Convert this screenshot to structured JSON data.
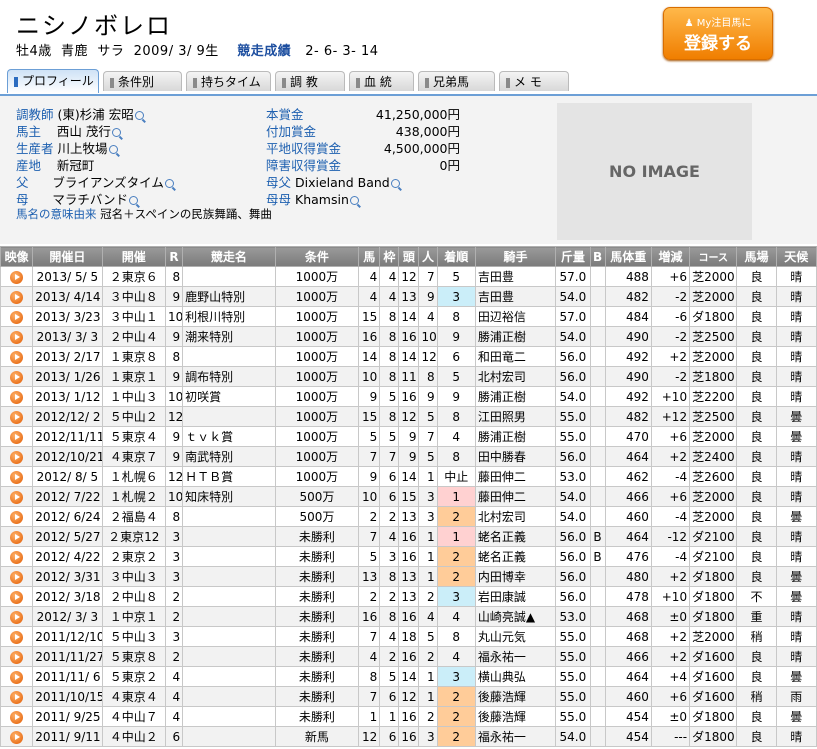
{
  "horse": {
    "name": "ニシノボレロ",
    "sex_age": "牡4歳",
    "color": "青鹿",
    "breed": "サラ",
    "birth": "2009/ 3/ 9生",
    "record_label": "競走成績",
    "record": "2- 6- 3- 14"
  },
  "register_button": {
    "small": "My注目馬に",
    "big": "登録する"
  },
  "tabs": [
    "プロフィール",
    "条件別",
    "持ちタイム",
    "調 教",
    "血 統",
    "兄弟馬",
    "メ モ"
  ],
  "profile": {
    "trainer_label": "調教師",
    "trainer": "(東)杉浦 宏昭",
    "owner_label": "馬主",
    "owner": "西山 茂行",
    "breeder_label": "生産者",
    "breeder": "川上牧場",
    "origin_label": "産地",
    "origin": "新冠町",
    "sire_label": "父",
    "sire": "ブライアンズタイム",
    "dam_label": "母",
    "dam": "マラチバンド",
    "meaning_label": "馬名の意味由来",
    "meaning": "冠名＋スペインの民族舞踊、舞曲",
    "prize_label": "本賞金",
    "prize": "41,250,000円",
    "extra_label": "付加賞金",
    "extra": "438,000円",
    "flat_label": "平地収得賞金",
    "flat": "4,500,000円",
    "hurdle_label": "障害収得賞金",
    "hurdle": "0円",
    "damsire_label": "母父",
    "damsire": "Dixieland Band",
    "damdam_label": "母母",
    "damdam": "Khamsin",
    "no_image": "NO IMAGE"
  },
  "table": {
    "headers": [
      "映像",
      "開催日",
      "開催",
      "R",
      "競走名",
      "条件",
      "馬",
      "枠",
      "頭",
      "人",
      "着順",
      "騎手",
      "斤量",
      "B",
      "馬体重",
      "増減",
      "コース",
      "馬場",
      "天候"
    ],
    "rows": [
      [
        "2013/ 5/ 5",
        "２東京６",
        "8",
        "",
        "1000万",
        "4",
        "4",
        "12",
        "7",
        "5",
        "吉田豊",
        "57.0",
        "",
        "488",
        "+6",
        "芝2000",
        "良",
        "晴"
      ],
      [
        "2013/ 4/14",
        "３中山８",
        "9",
        "鹿野山特別",
        "1000万",
        "4",
        "4",
        "13",
        "9",
        "3",
        "吉田豊",
        "54.0",
        "",
        "482",
        "-2",
        "芝2000",
        "良",
        "晴"
      ],
      [
        "2013/ 3/23",
        "３中山１",
        "10",
        "利根川特別",
        "1000万",
        "15",
        "8",
        "14",
        "4",
        "8",
        "田辺裕信",
        "57.0",
        "",
        "484",
        "-6",
        "ダ1800",
        "良",
        "晴"
      ],
      [
        "2013/ 3/ 3",
        "２中山４",
        "9",
        "潮来特別",
        "1000万",
        "16",
        "8",
        "16",
        "10",
        "9",
        "勝浦正樹",
        "54.0",
        "",
        "490",
        "-2",
        "芝2500",
        "良",
        "晴"
      ],
      [
        "2013/ 2/17",
        "１東京８",
        "8",
        "",
        "1000万",
        "14",
        "8",
        "14",
        "12",
        "6",
        "和田竜二",
        "56.0",
        "",
        "492",
        "+2",
        "芝2000",
        "良",
        "晴"
      ],
      [
        "2013/ 1/26",
        "１東京１",
        "9",
        "調布特別",
        "1000万",
        "10",
        "8",
        "11",
        "8",
        "5",
        "北村宏司",
        "56.0",
        "",
        "490",
        "-2",
        "芝1800",
        "良",
        "晴"
      ],
      [
        "2013/ 1/12",
        "１中山３",
        "10",
        "初咲賞",
        "1000万",
        "9",
        "5",
        "16",
        "9",
        "9",
        "勝浦正樹",
        "54.0",
        "",
        "492",
        "+10",
        "芝2200",
        "良",
        "晴"
      ],
      [
        "2012/12/ 2",
        "５中山２",
        "12",
        "",
        "1000万",
        "15",
        "8",
        "12",
        "5",
        "8",
        "江田照男",
        "55.0",
        "",
        "482",
        "+12",
        "芝2500",
        "良",
        "曇"
      ],
      [
        "2012/11/11",
        "５東京４",
        "9",
        "ｔｖｋ賞",
        "1000万",
        "5",
        "5",
        "9",
        "7",
        "4",
        "勝浦正樹",
        "55.0",
        "",
        "470",
        "+6",
        "芝2000",
        "良",
        "曇"
      ],
      [
        "2012/10/21",
        "４東京７",
        "9",
        "南武特別",
        "1000万",
        "7",
        "7",
        "9",
        "5",
        "8",
        "田中勝春",
        "56.0",
        "",
        "464",
        "+2",
        "芝2400",
        "良",
        "晴"
      ],
      [
        "2012/ 8/ 5",
        "１札幌６",
        "12",
        "ＨＴＢ賞",
        "1000万",
        "9",
        "6",
        "14",
        "1",
        "中止",
        "藤田伸二",
        "53.0",
        "",
        "462",
        "-4",
        "芝2600",
        "良",
        "晴"
      ],
      [
        "2012/ 7/22",
        "１札幌２",
        "10",
        "知床特別",
        "500万",
        "10",
        "6",
        "15",
        "3",
        "1",
        "藤田伸二",
        "54.0",
        "",
        "466",
        "+6",
        "芝2000",
        "良",
        "晴"
      ],
      [
        "2012/ 6/24",
        "２福島４",
        "8",
        "",
        "500万",
        "2",
        "2",
        "13",
        "3",
        "2",
        "北村宏司",
        "54.0",
        "",
        "460",
        "-4",
        "芝2000",
        "良",
        "曇"
      ],
      [
        "2012/ 5/27",
        "２東京12",
        "3",
        "",
        "未勝利",
        "7",
        "4",
        "16",
        "1",
        "1",
        "蛯名正義",
        "56.0",
        "B",
        "464",
        "-12",
        "ダ2100",
        "良",
        "晴"
      ],
      [
        "2012/ 4/22",
        "２東京２",
        "3",
        "",
        "未勝利",
        "5",
        "3",
        "16",
        "1",
        "2",
        "蛯名正義",
        "56.0",
        "B",
        "476",
        "-4",
        "ダ2100",
        "良",
        "晴"
      ],
      [
        "2012/ 3/31",
        "３中山３",
        "3",
        "",
        "未勝利",
        "13",
        "8",
        "13",
        "1",
        "2",
        "内田博幸",
        "56.0",
        "",
        "480",
        "+2",
        "ダ1800",
        "良",
        "曇"
      ],
      [
        "2012/ 3/18",
        "２中山８",
        "2",
        "",
        "未勝利",
        "2",
        "2",
        "13",
        "2",
        "3",
        "岩田康誠",
        "56.0",
        "",
        "478",
        "+10",
        "ダ1800",
        "不",
        "曇"
      ],
      [
        "2012/ 3/ 3",
        "１中京１",
        "2",
        "",
        "未勝利",
        "16",
        "8",
        "16",
        "4",
        "4",
        "山崎亮誠▲",
        "53.0",
        "",
        "468",
        "±0",
        "ダ1800",
        "重",
        "晴"
      ],
      [
        "2011/12/10",
        "５中山３",
        "3",
        "",
        "未勝利",
        "7",
        "4",
        "18",
        "5",
        "8",
        "丸山元気",
        "55.0",
        "",
        "468",
        "+2",
        "芝2000",
        "稍",
        "晴"
      ],
      [
        "2011/11/27",
        "５東京８",
        "2",
        "",
        "未勝利",
        "4",
        "2",
        "16",
        "2",
        "4",
        "福永祐一",
        "55.0",
        "",
        "466",
        "+2",
        "ダ1600",
        "良",
        "晴"
      ],
      [
        "2011/11/ 6",
        "５東京２",
        "4",
        "",
        "未勝利",
        "8",
        "5",
        "14",
        "1",
        "3",
        "横山典弘",
        "55.0",
        "",
        "464",
        "+4",
        "ダ1600",
        "良",
        "曇"
      ],
      [
        "2011/10/15",
        "４東京４",
        "4",
        "",
        "未勝利",
        "7",
        "6",
        "12",
        "1",
        "2",
        "後藤浩輝",
        "55.0",
        "",
        "460",
        "+6",
        "ダ1600",
        "稍",
        "雨"
      ],
      [
        "2011/ 9/25",
        "４中山７",
        "4",
        "",
        "未勝利",
        "1",
        "1",
        "16",
        "2",
        "2",
        "後藤浩輝",
        "55.0",
        "",
        "454",
        "±0",
        "ダ1800",
        "良",
        "曇"
      ],
      [
        "2011/ 9/11",
        "４中山２",
        "6",
        "",
        "新馬",
        "12",
        "6",
        "16",
        "3",
        "2",
        "福永祐一",
        "54.0",
        "",
        "454",
        "---",
        "ダ1800",
        "良",
        "晴"
      ]
    ]
  }
}
